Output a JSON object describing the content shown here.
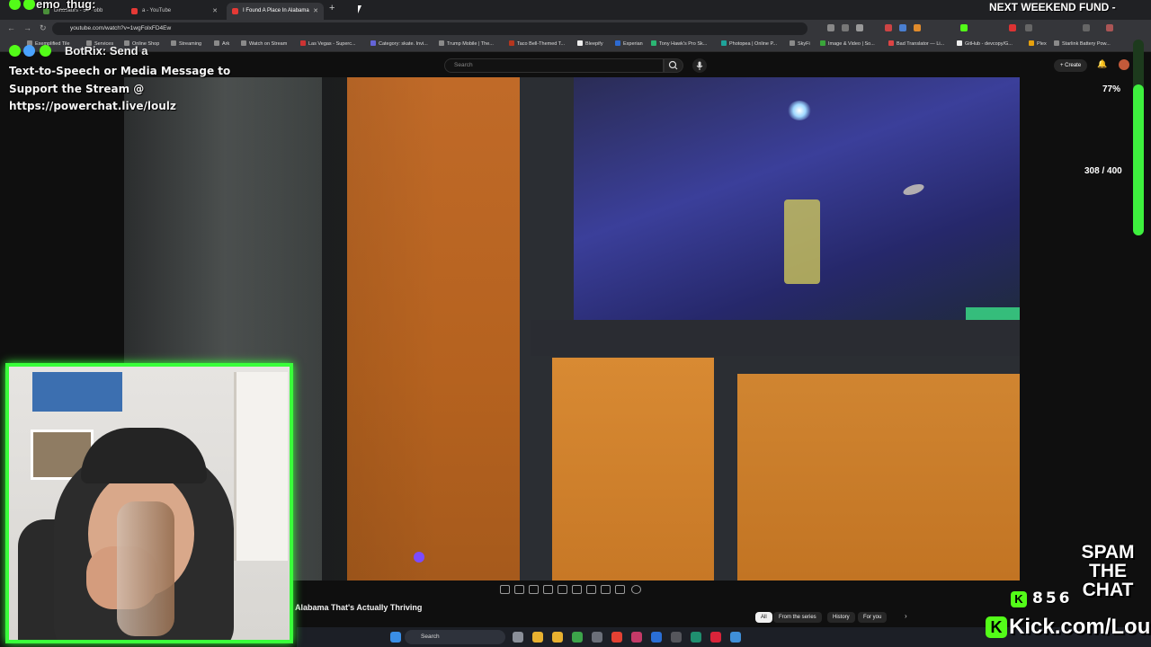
{
  "browser": {
    "tabs": [
      {
        "label": "Dinosaurs - 54 - bbb"
      },
      {
        "label": "a - YouTube"
      },
      {
        "label": "I Found A Place In Alabama"
      }
    ],
    "url": "youtube.com/watch?v=1wgFolxFD4Ew",
    "bookmarks": [
      "Exemplified Tile",
      "Services",
      "Online Shop",
      "Streaming",
      "Ark",
      "Watch on Stream",
      "Las Vegas - Superc...",
      "Category: skate. Invi...",
      "Trump Mobile | The...",
      "Taco Bell-Themed T...",
      "Bleepify",
      "Experian",
      "Tony Hawk's Pro Sk...",
      "Photopea | Online P...",
      "SkyFi",
      "Image & Video | So...",
      "Bad Translator — Li...",
      "GitHub - devcopy/G...",
      "Plex",
      "Starlink Battery Pow..."
    ]
  },
  "youtube": {
    "search_placeholder": "Search",
    "create_label": "Create",
    "video_title": "Alabama That's Actually Thriving",
    "chips": [
      "All",
      "From the series",
      "History",
      "For you"
    ]
  },
  "taskbar": {
    "search_label": "Search"
  },
  "overlay": {
    "top_user": "emo_thug:",
    "bot_name": "BotRix:",
    "bot_first_words": "Send a",
    "chat_message": "Text-to-Speech or Media Message to Support the Stream @ https://powerchat.live/loulz",
    "fund_label": "NEXT WEEKEND FUND -",
    "fund_percent_text": "77%",
    "fund_percent": 0.77,
    "goal_text": "308 / 400",
    "spam_lines": [
      "SPAM",
      "THE",
      "CHAT"
    ],
    "kick_viewers": "856",
    "kick_url": "Kick.com/Loulz"
  },
  "colors": {
    "kick_green": "#53fc18",
    "cam_border": "#39ff3a",
    "yt_bg": "#0f0f0f"
  }
}
